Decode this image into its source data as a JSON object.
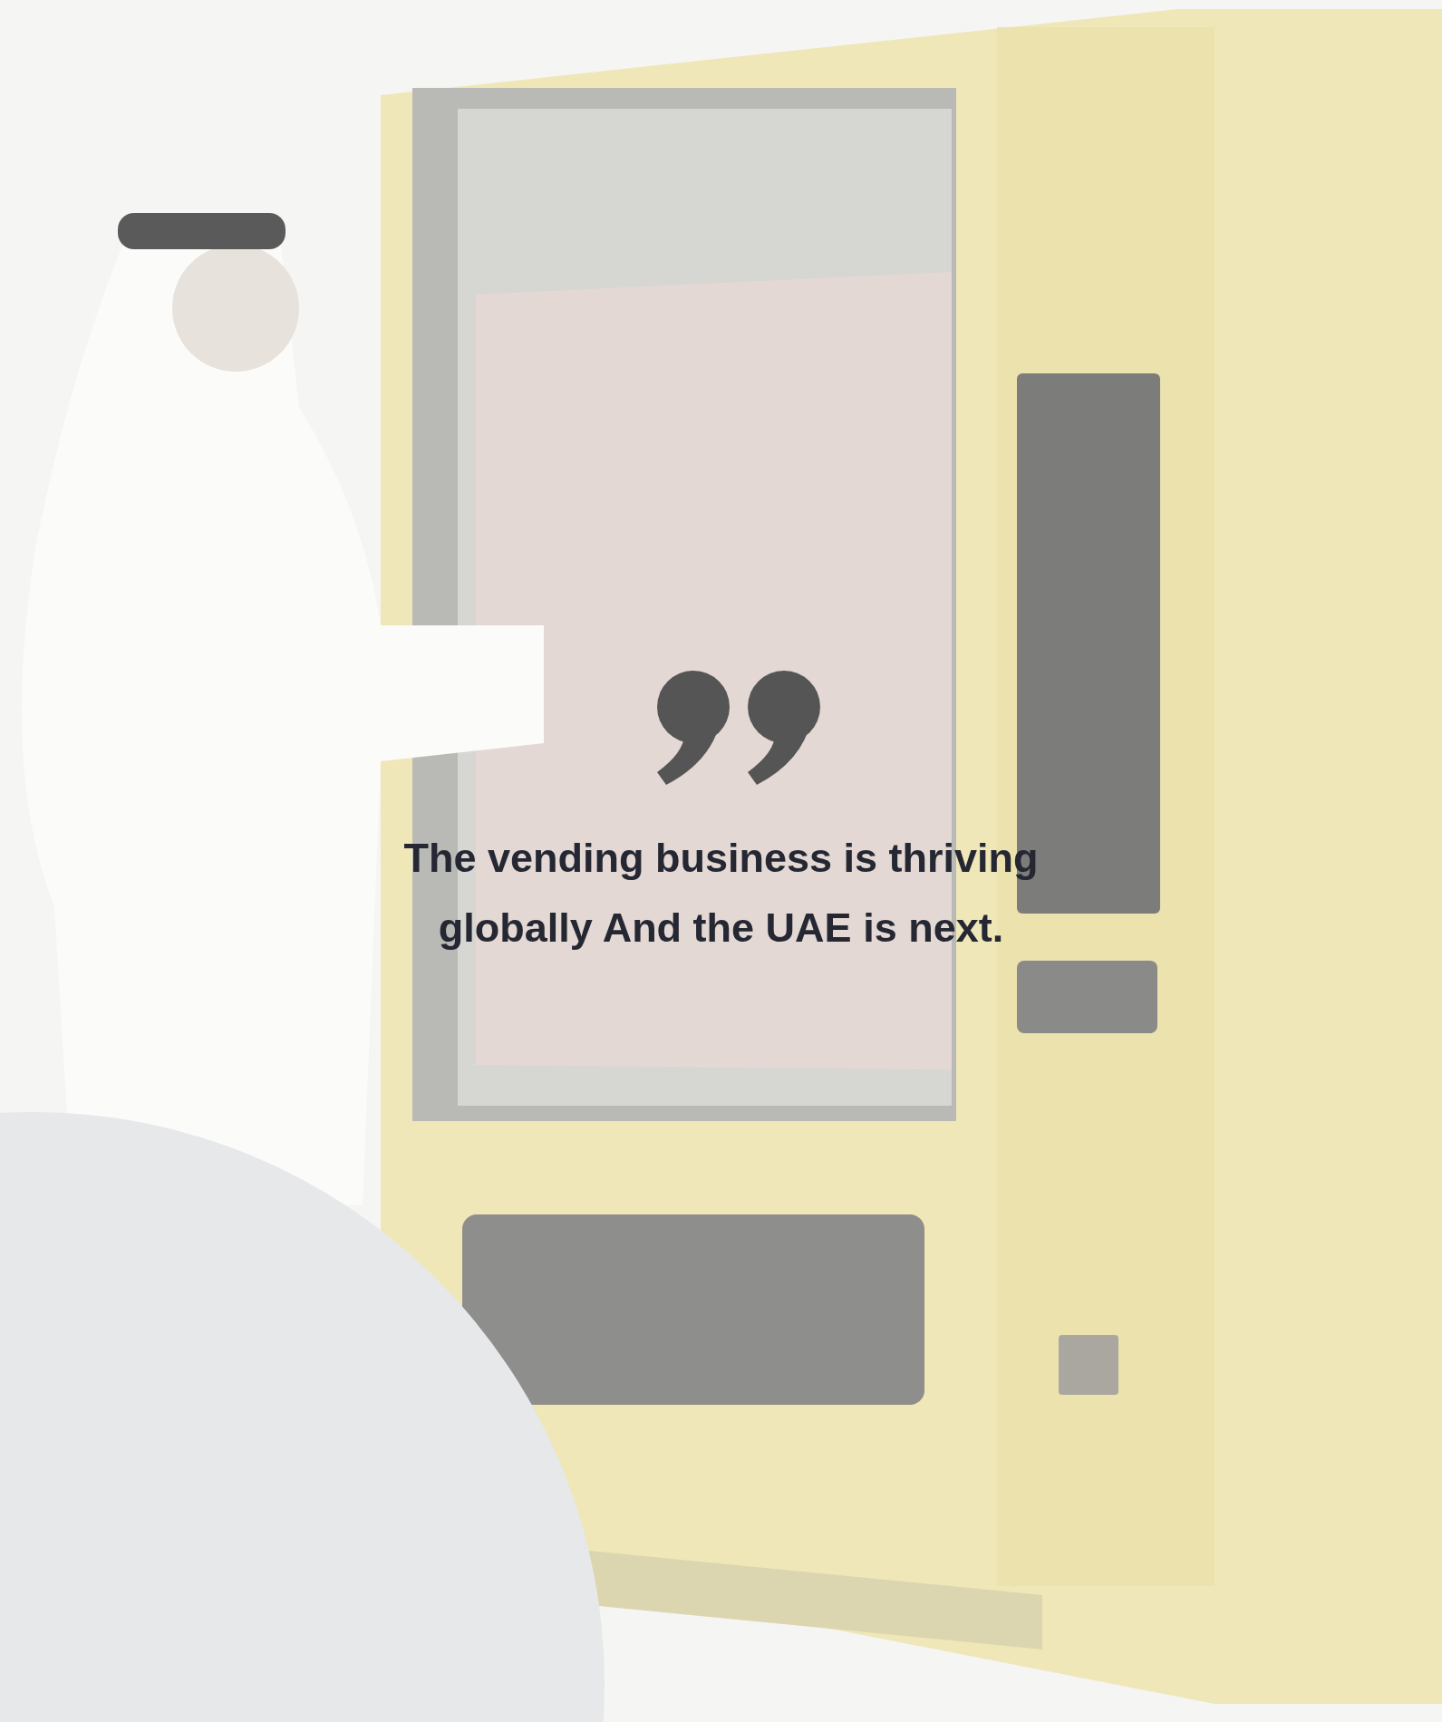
{
  "quote": {
    "text": "The vending business is thriving globally And the UAE is next."
  }
}
